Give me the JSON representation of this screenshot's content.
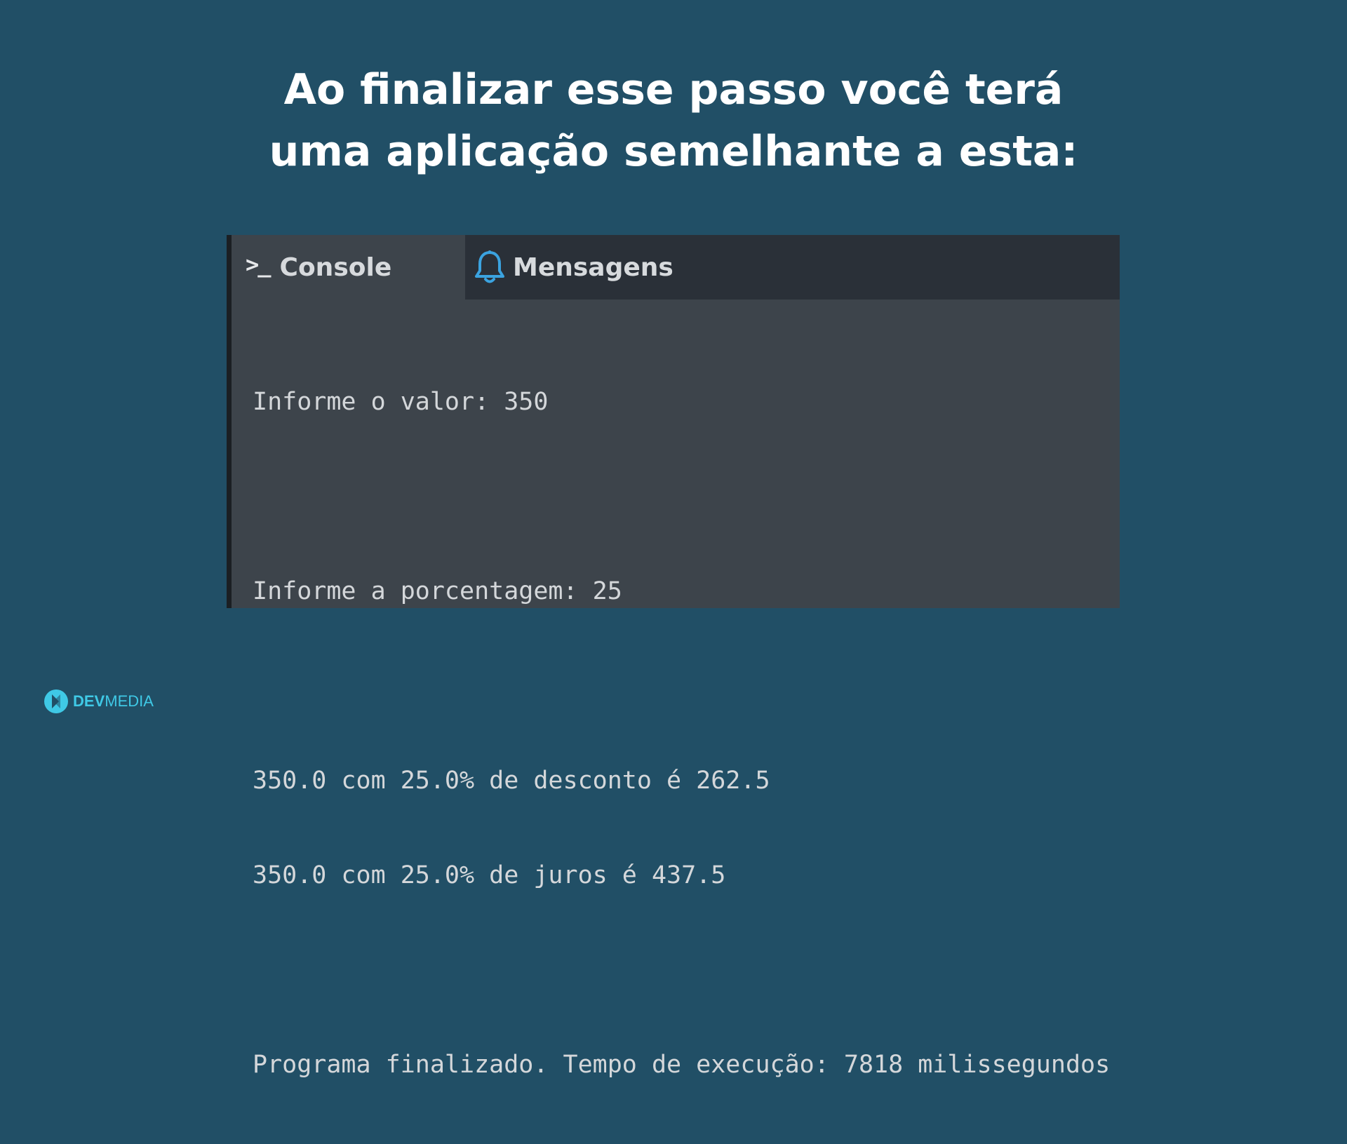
{
  "headline": {
    "line1": "Ao finalizar esse passo você terá",
    "line2": "uma aplicação semelhante a esta:"
  },
  "tabs": {
    "console": {
      "label": "Console",
      "icon": "terminal-prompt-icon",
      "icon_glyph": ">_",
      "active": true
    },
    "mensagens": {
      "label": "Mensagens",
      "icon": "bell-icon",
      "active": false
    }
  },
  "console": {
    "lines": [
      "Informe o valor: 350",
      "Informe a porcentagem: 25",
      "350.0 com 25.0% de desconto é 262.5",
      "350.0 com 25.0% de juros é 437.5",
      "Programa finalizado. Tempo de execução: 7818 milissegundos"
    ]
  },
  "logo": {
    "dev": "DEV",
    "media": "MEDIA",
    "icon": "devmedia-logo-icon"
  },
  "colors": {
    "background": "#214f66",
    "console_bg": "#3d444b",
    "tabbar_bg": "#2a3038",
    "bell": "#3ba3e0",
    "logo": "#3fc9e6"
  }
}
